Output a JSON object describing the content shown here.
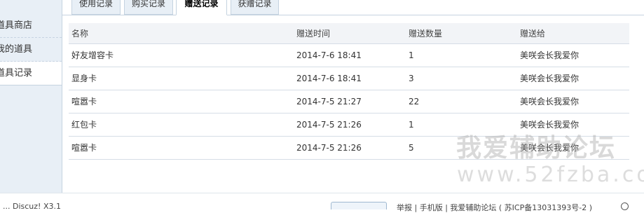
{
  "sidebar": {
    "items": [
      {
        "label": "道具商店"
      },
      {
        "label": "我的道具"
      },
      {
        "label": "道具记录"
      }
    ]
  },
  "tabs": [
    {
      "label": "使用记录",
      "active": false
    },
    {
      "label": "购买记录",
      "active": false
    },
    {
      "label": "赠送记录",
      "active": true
    },
    {
      "label": "获赠记录",
      "active": false
    }
  ],
  "table": {
    "headers": [
      "名称",
      "赠送时间",
      "赠送数量",
      "赠送给"
    ],
    "rows": [
      [
        "好友增容卡",
        "2014-7-6 18:41",
        "1",
        "美咲会长我爱你"
      ],
      [
        "显身卡",
        "2014-7-6 18:41",
        "3",
        "美咲会长我爱你"
      ],
      [
        "喧嚣卡",
        "2014-7-5 21:27",
        "22",
        "美咲会长我爱你"
      ],
      [
        "红包卡",
        "2014-7-5 21:26",
        "1",
        "美咲会长我爱你"
      ],
      [
        "喧嚣卡",
        "2014-7-5 21:26",
        "5",
        "美咲会长我爱你"
      ]
    ]
  },
  "watermark": {
    "line1": "我爱辅助论坛",
    "line2": "www.52fzba.com"
  },
  "footer": {
    "left_text": "... Discuz! X3.1",
    "right_text": "举报 | 手机版 | 我爱辅助论坛 ( 苏ICP备13031393号-2 )"
  },
  "colors": {
    "sidebar_bg": "#e8eff6",
    "border": "#c5d3e0",
    "header_bg": "#f2f4f7"
  }
}
